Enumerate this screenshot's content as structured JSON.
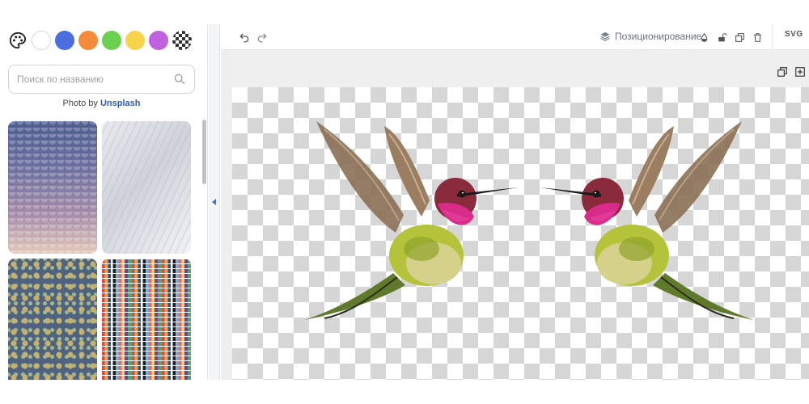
{
  "swatches": {
    "palette_icon": "palette-icon",
    "colors": [
      "#ffffff",
      "#4a6ee0",
      "#f48b3a",
      "#6bd14f",
      "#f7d44a",
      "#c062e0"
    ],
    "transparent_icon": "checker-icon"
  },
  "search": {
    "placeholder": "Поиск по названию",
    "icon": "search-icon"
  },
  "credit": {
    "prefix": "Photo by",
    "link": "Unsplash"
  },
  "toolbar": {
    "undo_icon": "undo-icon",
    "redo_icon": "redo-icon",
    "positioning_label": "Позиционирование",
    "svg_label": "SVG"
  },
  "colors": {
    "accent": "#4a6fd0",
    "checker": "#d6d6d6"
  }
}
